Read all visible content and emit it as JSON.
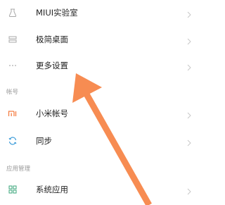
{
  "settings": {
    "items_top": [
      {
        "label": "MIUI实验室",
        "icon": "flask-icon"
      },
      {
        "label": "极简桌面",
        "icon": "minimal-desktop-icon"
      },
      {
        "label": "更多设置",
        "icon": "more-dots-icon"
      }
    ],
    "account_section_header": "帐号",
    "account_items": [
      {
        "label": "小米帐号",
        "icon": "mi-logo-icon"
      },
      {
        "label": "同步",
        "icon": "sync-icon"
      }
    ],
    "apps_section_header": "应用管理",
    "apps_items": [
      {
        "label": "系统应用",
        "icon": "apps-grid-icon"
      }
    ]
  },
  "colors": {
    "accent_orange": "#f47d43",
    "icon_gray": "#a8a8a8",
    "section_gray": "#9a9a9a",
    "chevron_gray": "#c8c8c8",
    "arrow": "#f78c52"
  }
}
